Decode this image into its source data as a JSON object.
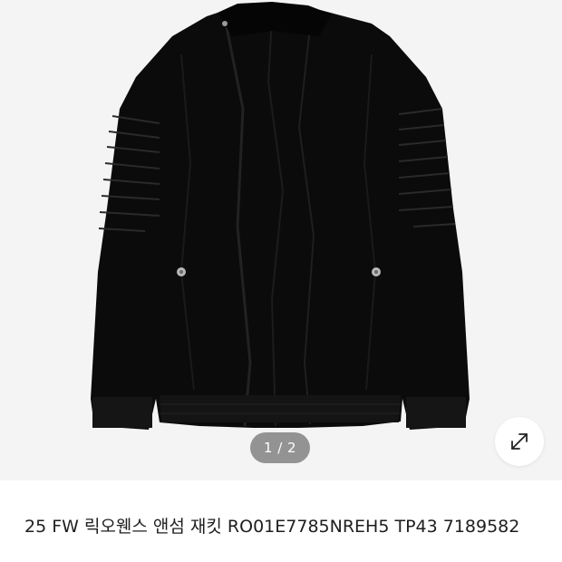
{
  "gallery": {
    "current_page": 1,
    "total_pages": 2,
    "pager_text": "1 / 2",
    "image_label": "black jacket product photo",
    "background_color": "#f4f4f4",
    "expand_icon": "expand-diagonal-arrows-icon"
  },
  "product": {
    "title": "25 FW 릭오웬스 앤섬 재킷 RO01E7785NREH5 TP43 7189582"
  }
}
